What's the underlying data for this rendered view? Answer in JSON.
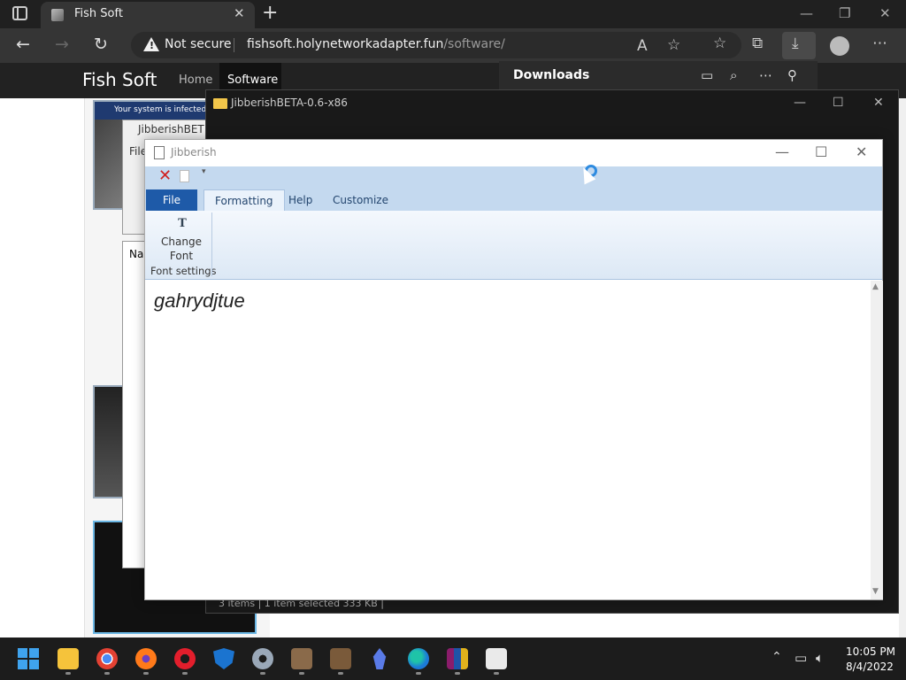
{
  "browser": {
    "tab_title": "Fish Soft",
    "tab_close": "✕",
    "new_tab": "+",
    "not_secure": "Not secure",
    "url_host": "fishsoft.holynetworkadapter.fun",
    "url_path": "/software/",
    "window_minimize": "—",
    "window_restore": "❐",
    "window_close": "✕"
  },
  "site": {
    "brand": "Fish Soft",
    "nav_home": "Home",
    "nav_software": "Software",
    "thumb1_banner": "Your system is infected!"
  },
  "downloads": {
    "title": "Downloads"
  },
  "explorer": {
    "title": "JibberishBETA-0.6-x86",
    "status": "3 items   |   1 item selected  333 KB   |"
  },
  "winrar": {
    "title": "JibberishBET",
    "file_menu": "File"
  },
  "filelist": {
    "name_header": "Nar"
  },
  "jibberish": {
    "title": "Jibberish",
    "tabs": [
      "File",
      "Formatting",
      "Help",
      "Customize"
    ],
    "change_font_line1": "Change",
    "change_font_line2": "Font",
    "group_label": "Font settings",
    "editor_text": "gahrydjtue"
  },
  "taskbar": {
    "time": "10:05 PM",
    "date": "8/4/2022"
  },
  "colors": {
    "ribbon": "#c4d9ef",
    "file_tab": "#1e5aa8",
    "accent_blue": "#2e8be0"
  }
}
